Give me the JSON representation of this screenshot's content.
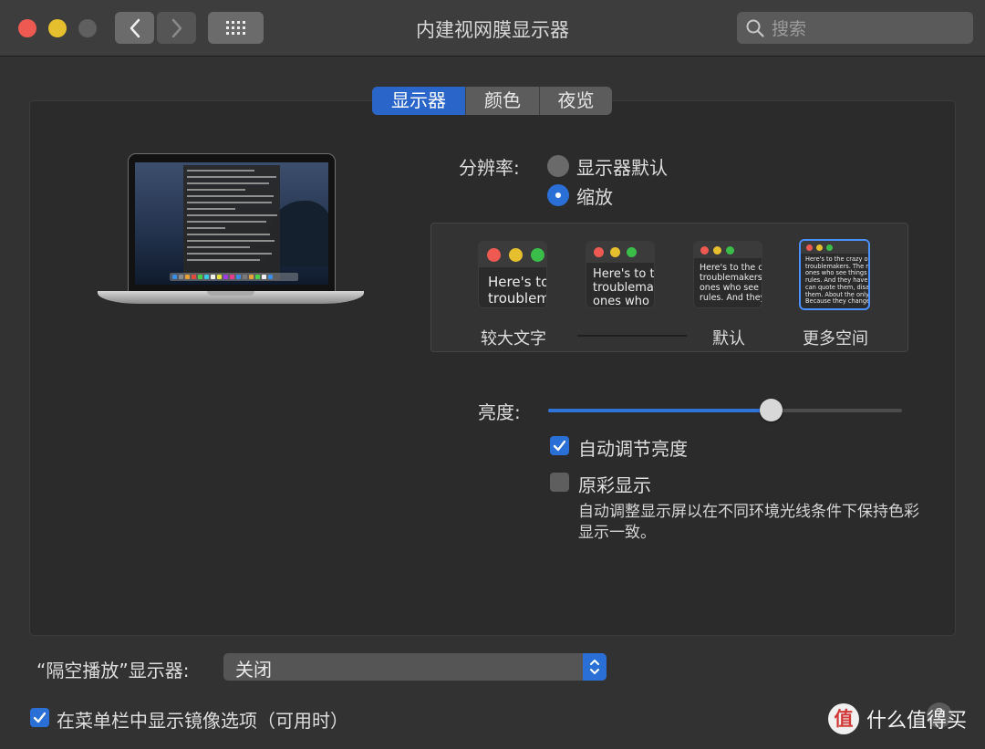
{
  "window": {
    "title": "内建视网膜显示器"
  },
  "search": {
    "placeholder": "搜索"
  },
  "tabs": [
    {
      "label": "显示器",
      "active": true
    },
    {
      "label": "颜色",
      "active": false
    },
    {
      "label": "夜览",
      "active": false
    }
  ],
  "resolution": {
    "label": "分辨率:",
    "options": [
      {
        "label": "显示器默认",
        "selected": false
      },
      {
        "label": "缩放",
        "selected": true
      }
    ]
  },
  "scaling": {
    "options": [
      {
        "label": "较大文字",
        "preview": "Here's to\ntroublem"
      },
      {
        "label": "",
        "preview": "Here's to t\ntroublema\nones who"
      },
      {
        "label": "默认",
        "preview": "Here's to the cr\ntroublemakers.\nones who see t\nrules. And they"
      },
      {
        "label": "更多空间",
        "preview": "Here's to the crazy ones\ntroublemakers. The rou\nones who see things dif\nrules. And they have no\ncan quote them, disagre\nthem. About the only th\nBecause they change th",
        "selected": true
      }
    ]
  },
  "brightness": {
    "label": "亮度:",
    "value": 0.63,
    "auto_label": "自动调节亮度",
    "auto_checked": true
  },
  "true_tone": {
    "label": "原彩显示",
    "checked": false,
    "description": "自动调整显示屏以在不同环境光线条件下保持色彩显示一致。"
  },
  "airplay": {
    "label": "“隔空播放”显示器:",
    "value": "关闭"
  },
  "mirroring": {
    "label": "在菜单栏中显示镜像选项（可用时）",
    "checked": true
  },
  "help": {
    "label": "?"
  },
  "watermark": {
    "logo": "值",
    "text": "什么值得买"
  },
  "colors": {
    "accent": "#2a6fd6",
    "background": "#323232",
    "panel": "#2b2b2b"
  }
}
